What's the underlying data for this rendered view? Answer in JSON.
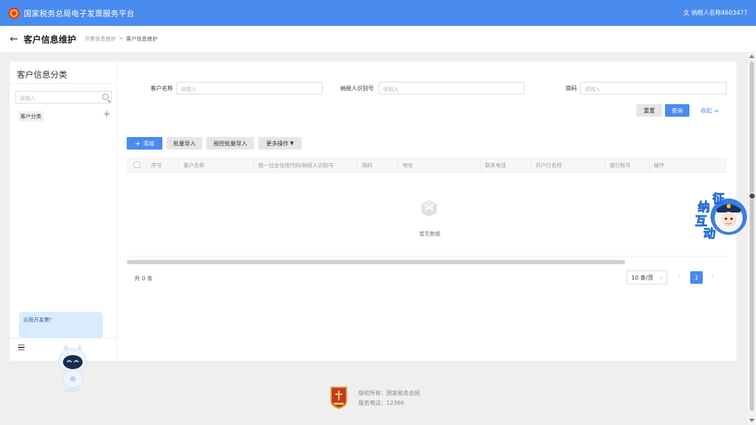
{
  "header": {
    "app_title": "国家税务总局电子发票服务平台",
    "user_label": "纳税人名称4603477"
  },
  "page": {
    "title": "客户信息维护",
    "breadcrumb": [
      "开票信息维护",
      "客户信息维护"
    ]
  },
  "sidebar": {
    "title": "客户信息分类",
    "search_placeholder": "请输入",
    "category": "客户分类"
  },
  "form": {
    "customer_name_label": "客户名称",
    "taxpayer_id_label": "纳税人识别号",
    "short_name_label": "简码",
    "placeholder": "请输入",
    "reset_label": "重置",
    "query_label": "查询",
    "collapse_label": "收起"
  },
  "toolbar": {
    "add_label": "添加",
    "batch_import_label": "批量导入",
    "tax_batch_import_label": "税控批量导入",
    "more_label": "更多操作"
  },
  "table": {
    "columns": [
      "序号",
      "客户名称",
      "统一社会信用代码/纳税人识别号",
      "简码",
      "地址",
      "联系电话",
      "开户行名称",
      "银行账号",
      "操作"
    ],
    "empty_text": "暂无数据"
  },
  "pagination": {
    "total_text": "共 0 条",
    "page_size": "10 条/页",
    "current_page": "1"
  },
  "assistant": {
    "bubble_text": "点我开发票!",
    "badge_chars": [
      "征",
      "纳",
      "互",
      "动"
    ]
  },
  "footer": {
    "copyright": "版权所有：国家税务总局",
    "hotline": "服务电话：12366"
  },
  "colors": {
    "primary": "#4a8bef",
    "background": "#efefef"
  }
}
